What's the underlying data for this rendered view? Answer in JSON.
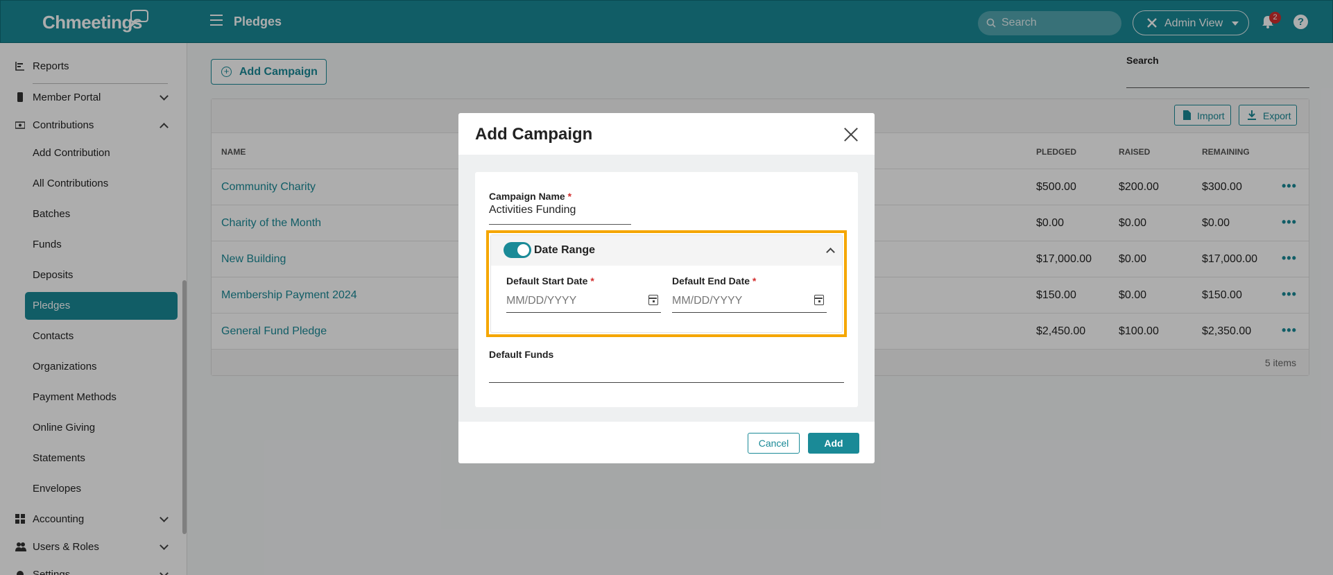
{
  "header": {
    "logo_text": "Chmeetings",
    "page_title": "Pledges",
    "search_placeholder": "Search",
    "admin_view_label": "Admin View",
    "notification_count": "2",
    "help_label": "?"
  },
  "sidebar": {
    "items": [
      {
        "label": "Reports",
        "icon": "chart-bar-icon"
      },
      {
        "label": "Member Portal",
        "icon": "mobile-icon"
      },
      {
        "label": "Contributions",
        "icon": "money-icon"
      },
      {
        "label": "Add Contribution"
      },
      {
        "label": "All Contributions"
      },
      {
        "label": "Batches"
      },
      {
        "label": "Funds"
      },
      {
        "label": "Deposits"
      },
      {
        "label": "Pledges",
        "active": true
      },
      {
        "label": "Contacts"
      },
      {
        "label": "Organizations"
      },
      {
        "label": "Payment Methods"
      },
      {
        "label": "Online Giving"
      },
      {
        "label": "Statements"
      },
      {
        "label": "Envelopes"
      },
      {
        "label": "Accounting",
        "icon": "grid-icon"
      },
      {
        "label": "Users & Roles",
        "icon": "users-icon"
      },
      {
        "label": "Settings",
        "icon": "gear-icon"
      }
    ]
  },
  "main": {
    "add_campaign_label": "Add Campaign",
    "search_label": "Search",
    "import_label": "Import",
    "export_label": "Export",
    "columns": {
      "name": "NAME",
      "pledged": "PLEDGED",
      "raised": "RAISED",
      "remaining": "REMAINING"
    },
    "rows": [
      {
        "name": "Community Charity",
        "pledged": "$500.00",
        "raised": "$200.00",
        "remaining": "$300.00"
      },
      {
        "name": "Charity of the Month",
        "pledged": "$0.00",
        "raised": "$0.00",
        "remaining": "$0.00"
      },
      {
        "name": "New Building",
        "pledged": "$17,000.00",
        "raised": "$0.00",
        "remaining": "$17,000.00"
      },
      {
        "name": "Membership Payment 2024",
        "pledged": "$150.00",
        "raised": "$0.00",
        "remaining": "$150.00"
      },
      {
        "name": "General Fund Pledge",
        "pledged": "$2,450.00",
        "raised": "$100.00",
        "remaining": "$2,350.00"
      }
    ],
    "footer_count": "5 items"
  },
  "modal": {
    "title": "Add Campaign",
    "campaign_name_label": "Campaign Name",
    "campaign_name_value": "Activities Funding",
    "required_mark": "*",
    "date_range_label": "Date Range",
    "date_range_enabled": true,
    "start_date_label": "Default Start Date",
    "start_date_placeholder": "MM/DD/YYYY",
    "end_date_label": "Default End Date",
    "end_date_placeholder": "MM/DD/YYYY",
    "default_funds_label": "Default Funds",
    "cancel_label": "Cancel",
    "add_label": "Add"
  },
  "colors": {
    "brand": "#1a8a97",
    "highlight": "#f5a600",
    "badge": "#d32f2f"
  }
}
